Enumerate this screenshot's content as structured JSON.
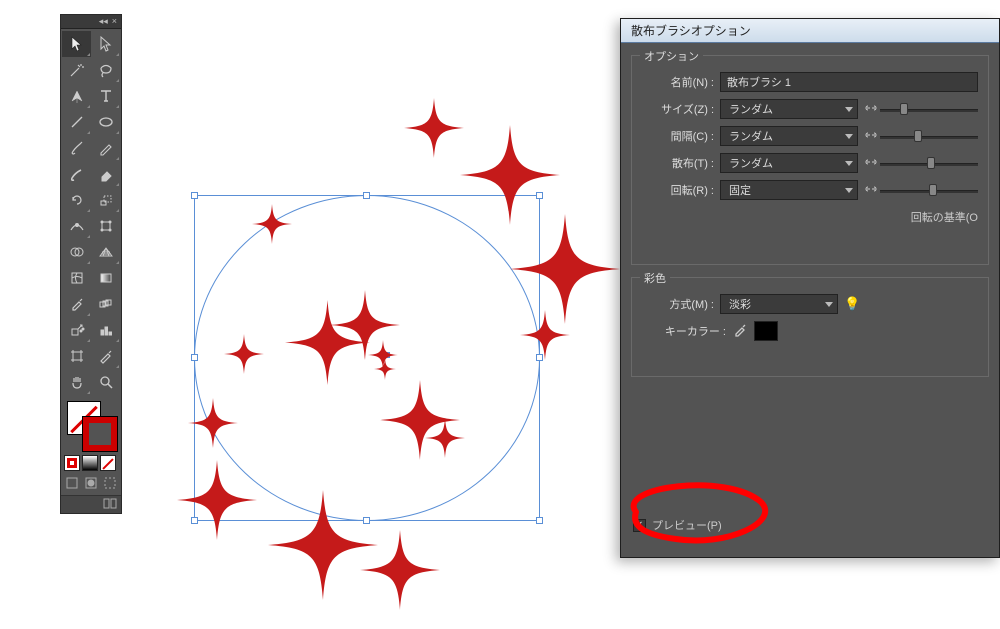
{
  "tools_panel": {
    "header_collapse": "◂◂",
    "header_close": "×"
  },
  "dialog": {
    "title": "散布ブラシオプション",
    "group_options": "オプション",
    "name_label": "名前(N) :",
    "name_value": "散布ブラシ 1",
    "size_label": "サイズ(Z) :",
    "size_value": "ランダム",
    "spacing_label": "間隔(C) :",
    "spacing_value": "ランダム",
    "scatter_label": "散布(T) :",
    "scatter_value": "ランダム",
    "rotation_label": "回転(R) :",
    "rotation_value": "固定",
    "rotation_basis_label": "回転の基準(O",
    "group_coloring": "彩色",
    "method_label": "方式(M) :",
    "method_value": "淡彩",
    "keycolor_label": "キーカラー :",
    "preview_label": "プレビュー(P)"
  }
}
